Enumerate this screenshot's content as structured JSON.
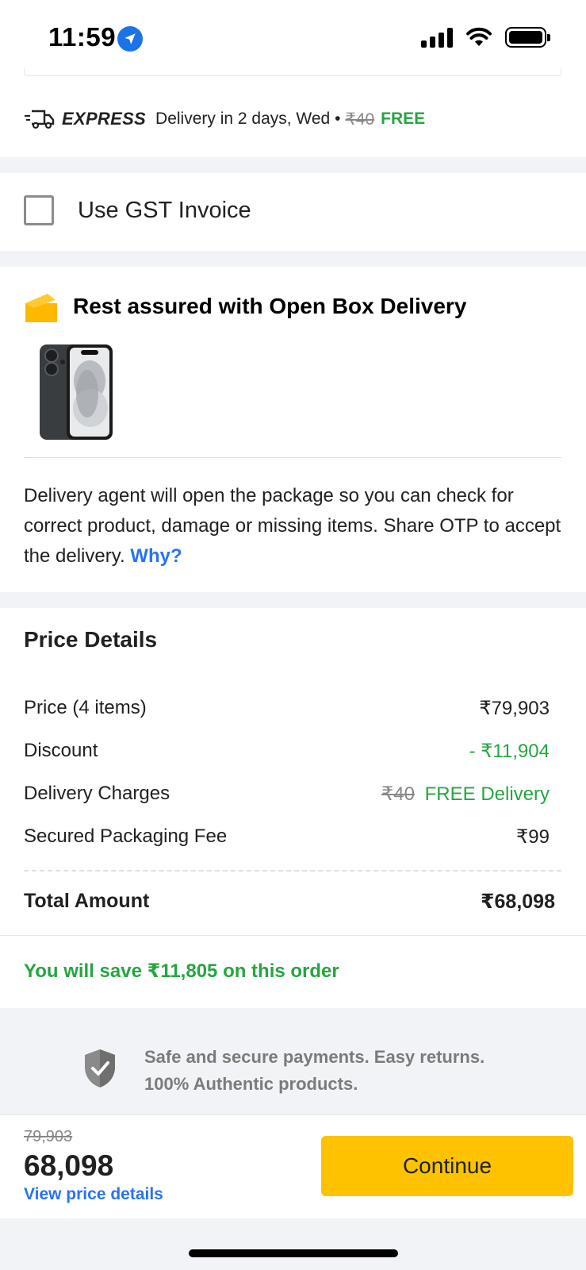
{
  "status_bar": {
    "time": "11:59",
    "location_icon": "location-arrow-icon",
    "signal_icon": "cellular-signal-icon",
    "wifi_icon": "wifi-icon",
    "battery_icon": "battery-icon"
  },
  "delivery": {
    "icon": "delivery-truck-icon",
    "label": "EXPRESS",
    "text": "Delivery in 2 days, Wed •",
    "old_charge": "₹40",
    "free_label": "FREE"
  },
  "gst": {
    "label": "Use GST Invoice",
    "checked": false
  },
  "open_box": {
    "icon": "open-box-icon",
    "title": "Rest assured with Open Box Delivery",
    "product_image": "phone-image",
    "description": "Delivery agent will open the package so you can check for correct product, damage or missing items. Share OTP to accept the delivery.",
    "why_link": "Why?"
  },
  "price_details": {
    "title": "Price Details",
    "rows": [
      {
        "label": "Price (4 items)",
        "value": "₹79,903"
      },
      {
        "label": "Discount",
        "value": "- ₹11,904"
      },
      {
        "label": "Delivery Charges",
        "old_value": "₹40",
        "value": "FREE Delivery"
      },
      {
        "label": "Secured Packaging Fee",
        "value": "₹99"
      }
    ],
    "total_label": "Total Amount",
    "total_value": "₹68,098",
    "savings": "You will save ₹11,805 on this order"
  },
  "secure": {
    "icon": "shield-check-icon",
    "line1": "Safe and secure payments. Easy returns.",
    "line2": "100% Authentic products."
  },
  "bottom_bar": {
    "original_price": "79,903",
    "final_price": "68,098",
    "view_details": "View price details",
    "continue_label": "Continue"
  },
  "colors": {
    "green": "#26a541",
    "blue_link": "#2874f0",
    "cta_yellow": "#ffc200",
    "separator": "#f1f3f6"
  }
}
